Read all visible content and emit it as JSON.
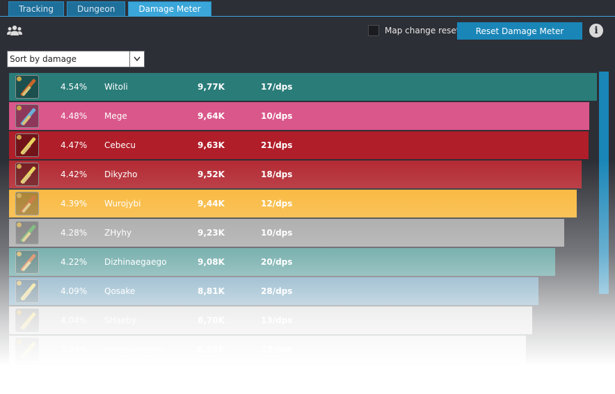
{
  "tabs": [
    {
      "label": "Tracking"
    },
    {
      "label": "Dungeon"
    },
    {
      "label": "Damage Meter"
    }
  ],
  "toolbar": {
    "map_change_reset_label": "Map change reset",
    "reset_button_label": "Reset Damage Meter",
    "info_icon": "i"
  },
  "sort": {
    "selected": "Sort by damage"
  },
  "colors": {
    "background": "#2d2f36",
    "accent": "#1a86b8"
  },
  "players": [
    {
      "percent": "4.54%",
      "name": "Witoli",
      "damage": "9,77K",
      "dps": "17/dps",
      "color": "#2a7c79",
      "share": 1.0,
      "weapon": "staff-icon"
    },
    {
      "percent": "4.48%",
      "name": "Mege",
      "damage": "9,64K",
      "dps": "10/dps",
      "color": "#d9578a",
      "share": 0.987,
      "weapon": "bow-icon"
    },
    {
      "percent": "4.47%",
      "name": "Cebecu",
      "damage": "9,63K",
      "dps": "21/dps",
      "color": "#b01e29",
      "share": 0.986,
      "weapon": "holy-staff-icon"
    },
    {
      "percent": "4.42%",
      "name": "Dikyzho",
      "damage": "9,52K",
      "dps": "18/dps",
      "color": "#b32a33",
      "share": 0.974,
      "weapon": "holy-staff-icon"
    },
    {
      "percent": "4.39%",
      "name": "Wurojybi",
      "damage": "9,44K",
      "dps": "12/dps",
      "color": "#f8b22c",
      "share": 0.966,
      "weapon": "sword-icon"
    },
    {
      "percent": "4.28%",
      "name": "ZHyhy",
      "damage": "9,23K",
      "dps": "10/dps",
      "color": "#9a9a9a",
      "share": 0.944,
      "weapon": "nature-staff-icon"
    },
    {
      "percent": "4.22%",
      "name": "Dizhinaegaego",
      "damage": "9,08K",
      "dps": "20/dps",
      "color": "#3a8c89",
      "share": 0.929,
      "weapon": "staff-icon"
    },
    {
      "percent": "4.09%",
      "name": "Qosake",
      "damage": "8,81K",
      "dps": "28/dps",
      "color": "#4a86a8",
      "share": 0.901,
      "weapon": "holy-staff-icon"
    },
    {
      "percent": "4.04%",
      "name": "SHaeby",
      "damage": "8,70K",
      "dps": "13/dps",
      "color": "#c8c8c8",
      "share": 0.89,
      "weapon": "holy-staff-icon"
    },
    {
      "percent": "3.99%",
      "name": "Kyraedynaeng",
      "damage": "8,59K",
      "dps": "12/dps",
      "color": "#d0d0d0",
      "share": 0.879,
      "weapon": "holy-staff-icon"
    }
  ]
}
